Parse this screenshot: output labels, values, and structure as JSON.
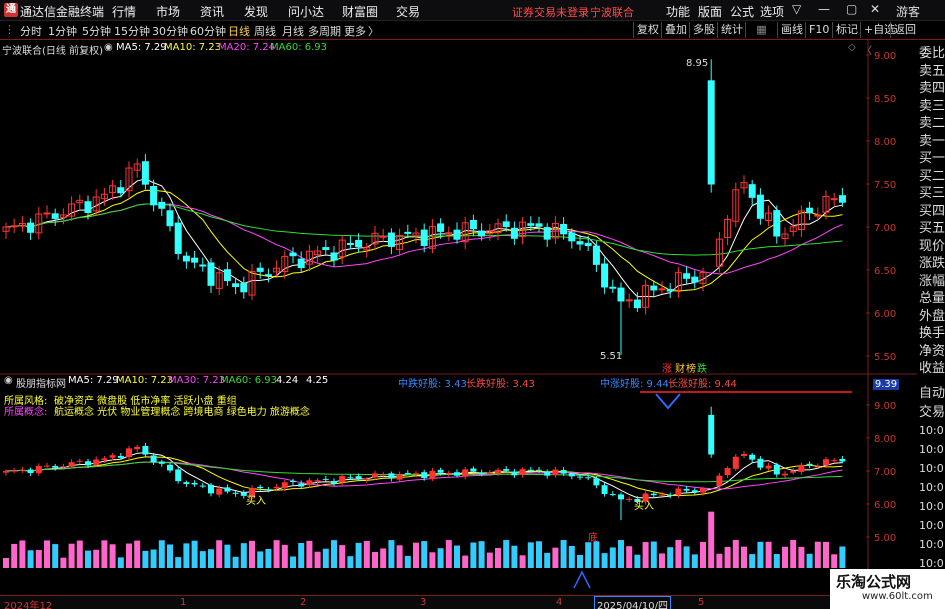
{
  "titlebar": {
    "app_name": "通达信金融终端",
    "menus": [
      "行情",
      "市场",
      "资讯",
      "发现",
      "问小达",
      "财富圈",
      "交易"
    ],
    "notice": "证券交易未登录",
    "stock": "宁波联合",
    "tools": [
      "功能",
      "版面",
      "公式",
      "选项"
    ],
    "guest": "游客",
    "controls": [
      "▽",
      "—",
      "▢",
      "✕"
    ]
  },
  "periodbar": {
    "periods": [
      "分时",
      "1分钟",
      "5分钟",
      "15分钟",
      "30分钟",
      "60分钟",
      "日线",
      "周线",
      "月线",
      "多周期",
      "更多"
    ],
    "active_period": "日线",
    "more_arrow": "〉",
    "right_buttons": [
      "复权",
      "叠加",
      "多股",
      "统计",
      "画线",
      "F10",
      "标记",
      "+自选",
      "返回"
    ]
  },
  "main_header": {
    "title": "宁波联合(日线 前复权)",
    "ma5": "MA5: 7.29",
    "ma10": "MA10: 7.23",
    "ma20": "MA20: 7.24",
    "ma60": "MA60: 6.93"
  },
  "main_axis": [
    "9.00",
    "8.50",
    "8.00",
    "7.50",
    "7.00",
    "6.50",
    "6.00",
    "5.50"
  ],
  "main_annotations": {
    "high": "8.95",
    "low": "5.51",
    "tag1": "涨",
    "tag2": "财",
    "tag3": "榜",
    "tag4": "跌"
  },
  "sub_header": {
    "title": "股朋指标网",
    "ma5": "MA5: 7.29",
    "ma10": "MA10: 7.23",
    "ma30": "MA30: 7.23",
    "ma60": "MA60: 6.93",
    "v1": "4.24",
    "v2": "4.25"
  },
  "sub_info": {
    "label1": "中跌好股: 3.43",
    "label2": "长跌好股: 3.43",
    "label3": "中涨好股: 9.44",
    "label4": "长涨好股: 9.44",
    "style_label": "所属风格:",
    "style_value": "破净资产 微盘股 低市净率 活跃小盘 重组",
    "concept_label": "所属概念:",
    "concept_value": "航运概念 光伏 物业管理概念 跨境电商 绿色电力 旅游概念",
    "buy1": "买入",
    "buy2": "买入",
    "bottom_mark": "底",
    "current": "9.39"
  },
  "sub_axis": [
    "9.00",
    "8.00",
    "7.00",
    "6.00",
    "5.00"
  ],
  "right_panel": {
    "main_items": [
      "委比",
      "卖五",
      "卖四",
      "卖三",
      "卖二",
      "卖一",
      "买一",
      "买二",
      "买三",
      "买四",
      "买五",
      "现价",
      "涨跌",
      "涨幅",
      "总量",
      "外盘",
      "换手",
      "净资",
      "收益"
    ],
    "sub_items": [
      "自动",
      "交易",
      "10:0",
      "10:0",
      "10:0",
      "10:0",
      "10:0",
      "10:0",
      "10:0",
      "10:0",
      "10:0"
    ]
  },
  "bottom_dates": [
    "2024年12",
    "1",
    "2",
    "3",
    "4",
    "2025/04/10/四",
    "5"
  ],
  "watermark": {
    "title": "乐淘公式网",
    "url": "www.60lt.com"
  },
  "colors": {
    "up": "#ff3333",
    "down": "#33ffff",
    "ma5": "#ffffff",
    "ma10": "#ffff00",
    "ma20": "#ff44ff",
    "ma60": "#33dd33"
  }
}
